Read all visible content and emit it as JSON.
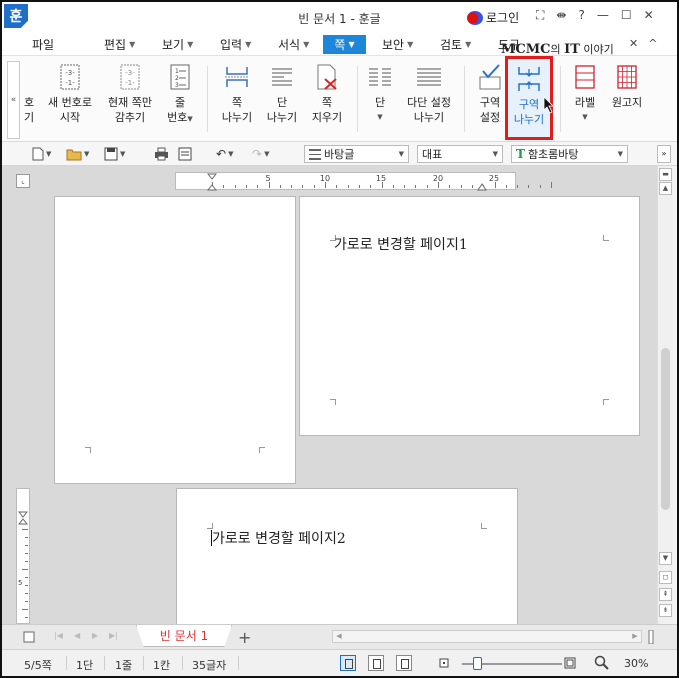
{
  "app": {
    "logo": "훈",
    "window_title": "빈 문서 1 - 훈글",
    "login_label": "로그인",
    "titlebar_icons": [
      "⛶",
      "⇼",
      "?",
      "—",
      "☐",
      "✕"
    ]
  },
  "menu": {
    "items": [
      {
        "label": "파일"
      },
      {
        "label": "편집"
      },
      {
        "label": "보기"
      },
      {
        "label": "입력"
      },
      {
        "label": "서식"
      },
      {
        "label": "쪽"
      },
      {
        "label": "보안"
      },
      {
        "label": "검토"
      },
      {
        "label": "도구"
      }
    ],
    "active_index": 5,
    "watermark": {
      "bold": "MCMC",
      "mid": "의 ",
      "bold2": "IT",
      "tail": " 이야기"
    },
    "right_icons": [
      "✕",
      "^"
    ]
  },
  "ribbon": {
    "collapse": "«",
    "buttons": [
      {
        "line1": "호",
        "line2": "기"
      },
      {
        "line1": "새 번호로",
        "line2": "시작"
      },
      {
        "line1": "현재 쪽만",
        "line2": "감추기"
      },
      {
        "line1": "줄",
        "line2": "번호"
      },
      {
        "line1": "쪽",
        "line2": "나누기"
      },
      {
        "line1": "단",
        "line2": "나누기"
      },
      {
        "line1": "쪽",
        "line2": "지우기"
      },
      {
        "line1": "단",
        "line2": ""
      },
      {
        "line1": "다단 설정",
        "line2": "나누기"
      },
      {
        "line1": "구역",
        "line2": "설정"
      },
      {
        "line1": "구역",
        "line2": "나누기"
      },
      {
        "line1": "라벨",
        "line2": ""
      },
      {
        "line1": "원고지",
        "line2": ""
      }
    ],
    "highlighted_index": 10,
    "highlight_color": "#e21b1b"
  },
  "format_toolbar": {
    "style_value": "바탕글",
    "outline_value": "대표",
    "font_value": "함초롬바탕"
  },
  "ruler": {
    "labels": [
      "5",
      "10",
      "15",
      "20",
      "25"
    ]
  },
  "document": {
    "page1_text": "가로로 변경할 페이지1",
    "page2_text": "가로로 변경할 페이지2"
  },
  "tabs": {
    "active_tab": "빈 문서 1",
    "add": "+"
  },
  "status": {
    "page": "5/5쪽",
    "column": "1단",
    "line": "1줄",
    "col": "1칸",
    "chars": "35글자",
    "zoom": "30%",
    "zoom_level_percent": 30
  },
  "colors": {
    "accent": "#1c86d8",
    "logo": "#1f6fc9",
    "tab_text": "#dd3333"
  }
}
